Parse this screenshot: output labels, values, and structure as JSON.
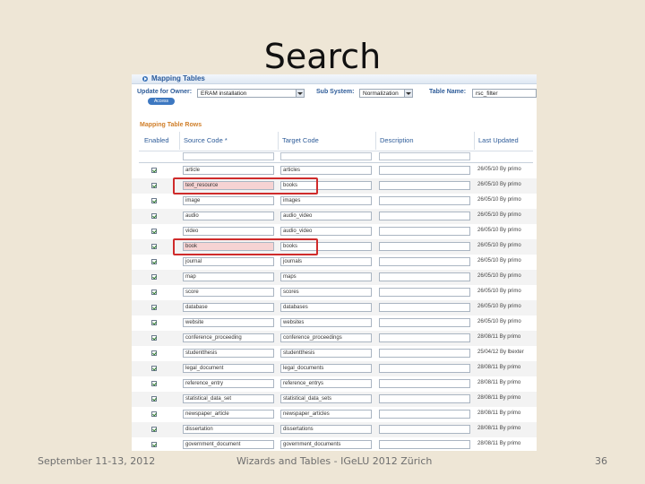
{
  "slide": {
    "title": "Search",
    "footer_left": "September 11-13, 2012",
    "footer_center": "Wizards and Tables - IGeLU 2012 Zürich",
    "page_number": "36"
  },
  "screenshot": {
    "panel_title": "Mapping Tables",
    "update_for_owner_label": "Update for Owner:",
    "owner_value": "ERAM installation",
    "access_button": "Access",
    "sub_system_label": "Sub System:",
    "sub_system_value": "Normalization",
    "table_name_label": "Table Name:",
    "table_name_value": "rsc_filter",
    "rows_title": "Mapping Table Rows",
    "columns": [
      "Enabled",
      "Source Code *",
      "Target Code",
      "Description",
      "Last Updated"
    ],
    "rows": [
      {
        "source": "article",
        "target": "articles",
        "updated": "26/05/10  By primo",
        "highlight": false
      },
      {
        "source": "text_resource",
        "target": "books",
        "updated": "26/05/10  By primo",
        "highlight": true
      },
      {
        "source": "image",
        "target": "images",
        "updated": "26/05/10  By primo",
        "highlight": false
      },
      {
        "source": "audio",
        "target": "audio_video",
        "updated": "26/05/10  By primo",
        "highlight": false
      },
      {
        "source": "video",
        "target": "audio_video",
        "updated": "26/05/10  By primo",
        "highlight": false
      },
      {
        "source": "book",
        "target": "books",
        "updated": "26/05/10  By primo",
        "highlight": true
      },
      {
        "source": "journal",
        "target": "journals",
        "updated": "26/05/10  By primo",
        "highlight": false
      },
      {
        "source": "map",
        "target": "maps",
        "updated": "26/05/10  By primo",
        "highlight": false
      },
      {
        "source": "score",
        "target": "scores",
        "updated": "26/05/10  By primo",
        "highlight": false
      },
      {
        "source": "database",
        "target": "databases",
        "updated": "26/05/10  By primo",
        "highlight": false
      },
      {
        "source": "website",
        "target": "websites",
        "updated": "26/05/10  By primo",
        "highlight": false
      },
      {
        "source": "conference_proceeding",
        "target": "conference_proceedings",
        "updated": "28/08/11  By primo",
        "highlight": false
      },
      {
        "source": "studentthesis",
        "target": "studentthesis",
        "updated": "25/04/12  By lbexter",
        "highlight": false
      },
      {
        "source": "legal_document",
        "target": "legal_documents",
        "updated": "28/08/11  By primo",
        "highlight": false
      },
      {
        "source": "reference_entry",
        "target": "reference_entrys",
        "updated": "28/08/11  By primo",
        "highlight": false
      },
      {
        "source": "statistical_data_set",
        "target": "statistical_data_sets",
        "updated": "28/08/11  By primo",
        "highlight": false
      },
      {
        "source": "newspaper_article",
        "target": "newspaper_articles",
        "updated": "28/08/11  By primo",
        "highlight": false
      },
      {
        "source": "dissertation",
        "target": "dissertations",
        "updated": "28/08/11  By primo",
        "highlight": false
      },
      {
        "source": "government_document",
        "target": "government_documents",
        "updated": "28/08/11  By primo",
        "highlight": false
      }
    ]
  }
}
